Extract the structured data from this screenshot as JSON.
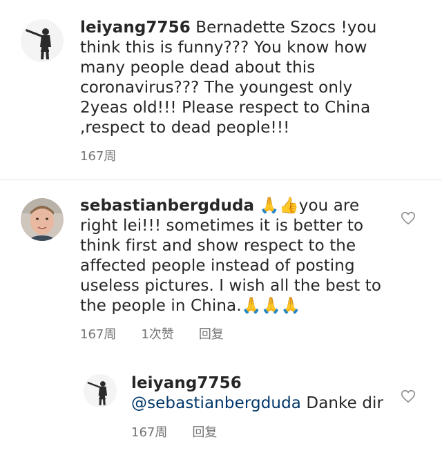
{
  "comments": [
    {
      "username": "leiyang7756",
      "text": " Bernadette Szocs !you think this is funny??? You know how many people dead about this coronavirus??? The youngest only 2yeas old!!! Please respect to China ,respect to dead people!!!",
      "meta": {
        "time": "167周"
      }
    },
    {
      "username": "sebastianbergduda",
      "emoji_lead": " 🙏👍",
      "text": "you are right lei!!! sometimes it is better to think first and show respect to the affected people instead of posting useless pictures. I wish all the best to the people in China.",
      "emoji_tail": "🙏🙏🙏",
      "meta": {
        "time": "167周",
        "likes": "1次赞",
        "reply": "回复"
      }
    }
  ],
  "reply": {
    "username": "leiyang7756",
    "mention": "@sebastianbergduda",
    "text": " Danke dir",
    "meta": {
      "time": "167周",
      "reply": "回复"
    }
  },
  "icons": {
    "heart": "heart-outline-icon",
    "avatar_silhouette": "soldier-silhouette-avatar",
    "avatar_photo": "man-photo-avatar"
  },
  "colors": {
    "text": "#262626",
    "meta": "#737373",
    "mention": "#00376b",
    "divider": "#e6e6e6"
  }
}
